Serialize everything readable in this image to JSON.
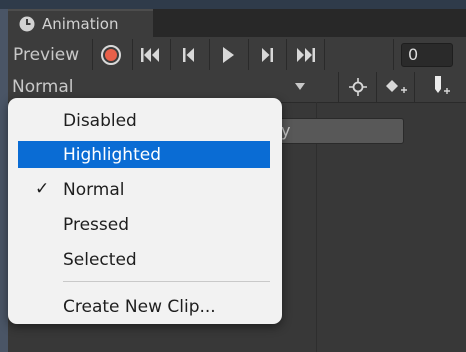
{
  "window": {
    "tab_title": "Animation",
    "tab_icon": "clock-icon"
  },
  "toolbar": {
    "preview_label": "Preview",
    "record_icon": "record-icon",
    "first_key_icon": "first-keyframe-icon",
    "prev_key_icon": "previous-keyframe-icon",
    "play_icon": "play-icon",
    "next_key_icon": "next-keyframe-icon",
    "last_key_icon": "last-keyframe-icon",
    "frame_value": "0"
  },
  "clip_bar": {
    "selected_clip": "Normal",
    "add_keyframe_icon": "add-keyframe-icon",
    "add_event_icon": "add-event-icon",
    "filter_icon": "target-icon"
  },
  "menu": {
    "items": [
      {
        "label": "Disabled",
        "checked": false,
        "highlighted": false
      },
      {
        "label": "Highlighted",
        "checked": false,
        "highlighted": true
      },
      {
        "label": "Normal",
        "checked": true,
        "highlighted": false
      },
      {
        "label": "Pressed",
        "checked": false,
        "highlighted": false
      },
      {
        "label": "Selected",
        "checked": false,
        "highlighted": false
      }
    ],
    "create_label": "Create New Clip...",
    "check_glyph": "✓"
  },
  "colors": {
    "highlight": "#0a6cd4",
    "record": "#e8604a",
    "panel": "#383838"
  }
}
